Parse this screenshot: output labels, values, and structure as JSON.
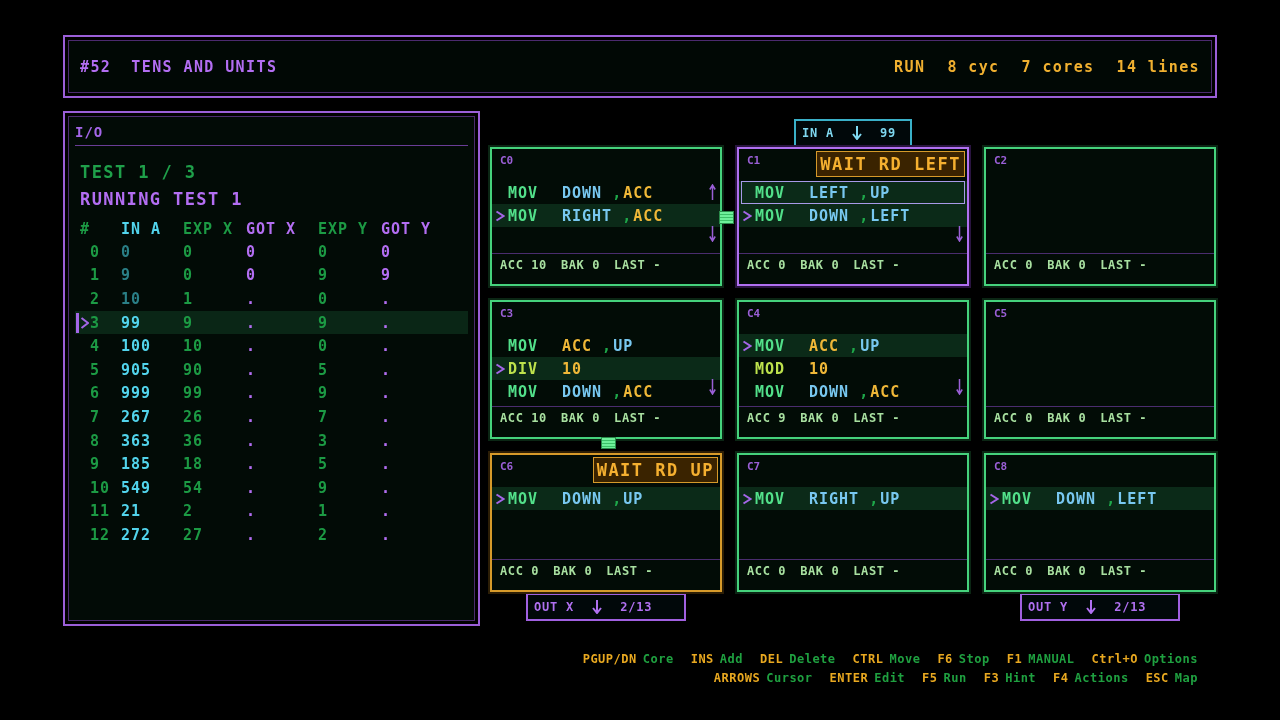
{
  "header": {
    "number": "#52",
    "title": "TENS AND UNITS",
    "stats": [
      "RUN",
      "8 cyc",
      "7 cores",
      "14 lines"
    ]
  },
  "io": {
    "title": "I/O",
    "test": "TEST 1 / 3",
    "status": "RUNNING TEST 1",
    "columns": [
      {
        "label": "#",
        "kind": "index"
      },
      {
        "label": "IN A",
        "kind": "input"
      },
      {
        "label": "EXP X",
        "kind": "expected"
      },
      {
        "label": "GOT X",
        "kind": "got"
      },
      {
        "label": "EXP Y",
        "kind": "expected"
      },
      {
        "label": "GOT Y",
        "kind": "got"
      }
    ],
    "rows": [
      {
        "cells": [
          "0",
          "0",
          "0",
          "0",
          "0",
          "0"
        ],
        "selected": false,
        "consumed": true
      },
      {
        "cells": [
          "1",
          "9",
          "0",
          "0",
          "9",
          "9"
        ],
        "selected": false,
        "consumed": true
      },
      {
        "cells": [
          "2",
          "10",
          "1",
          ".",
          "0",
          "."
        ],
        "selected": false,
        "consumed": true
      },
      {
        "cells": [
          "3",
          "99",
          "9",
          ".",
          "9",
          "."
        ],
        "selected": true,
        "consumed": false
      },
      {
        "cells": [
          "4",
          "100",
          "10",
          ".",
          "0",
          "."
        ],
        "selected": false,
        "consumed": false
      },
      {
        "cells": [
          "5",
          "905",
          "90",
          ".",
          "5",
          "."
        ],
        "selected": false,
        "consumed": false
      },
      {
        "cells": [
          "6",
          "999",
          "99",
          ".",
          "9",
          "."
        ],
        "selected": false,
        "consumed": false
      },
      {
        "cells": [
          "7",
          "267",
          "26",
          ".",
          "7",
          "."
        ],
        "selected": false,
        "consumed": false
      },
      {
        "cells": [
          "8",
          "363",
          "36",
          ".",
          "3",
          "."
        ],
        "selected": false,
        "consumed": false
      },
      {
        "cells": [
          "9",
          "185",
          "18",
          ".",
          "5",
          "."
        ],
        "selected": false,
        "consumed": false
      },
      {
        "cells": [
          "10",
          "549",
          "54",
          ".",
          "9",
          "."
        ],
        "selected": false,
        "consumed": false
      },
      {
        "cells": [
          "11",
          "21",
          "2",
          ".",
          "1",
          "."
        ],
        "selected": false,
        "consumed": false
      },
      {
        "cells": [
          "12",
          "272",
          "27",
          ".",
          "2",
          "."
        ],
        "selected": false,
        "consumed": false
      }
    ]
  },
  "columns": [
    {
      "cores": [
        {
          "label": "C0",
          "selected": false,
          "more_above": true,
          "more_below": true,
          "packet_right": true,
          "lines": [
            {
              "op": "MOV",
              "kind": "move",
              "args": [
                {
                  "text": "DOWN",
                  "kind": "port"
                },
                {
                  "text": "ACC",
                  "kind": "register"
                }
              ],
              "sep": ",",
              "current": false
            },
            {
              "op": "MOV",
              "kind": "move",
              "args": [
                {
                  "text": "RIGHT",
                  "kind": "port"
                },
                {
                  "text": "ACC",
                  "kind": "register"
                }
              ],
              "sep": ",",
              "current": true
            }
          ],
          "registers": [
            "ACC 10",
            "BAK 0",
            "LAST -"
          ]
        },
        {
          "label": "C3",
          "selected": false,
          "more_below": true,
          "packet_down": true,
          "lines": [
            {
              "op": "MOV",
              "kind": "move",
              "args": [
                {
                  "text": "ACC",
                  "kind": "register"
                },
                {
                  "text": "UP",
                  "kind": "port"
                }
              ],
              "sep": ",",
              "current": false
            },
            {
              "op": "DIV",
              "kind": "arith",
              "args": [
                {
                  "text": "10",
                  "kind": "number"
                }
              ],
              "current": true
            },
            {
              "op": "MOV",
              "kind": "move",
              "args": [
                {
                  "text": "DOWN",
                  "kind": "port"
                },
                {
                  "text": "ACC",
                  "kind": "register"
                }
              ],
              "sep": ",",
              "current": false
            }
          ],
          "registers": [
            "ACC 10",
            "BAK 0",
            "LAST -"
          ]
        },
        {
          "label": "C6",
          "selected": false,
          "wait": "WAIT RD UP",
          "lines": [
            {
              "op": "MOV",
              "kind": "move",
              "args": [
                {
                  "text": "DOWN",
                  "kind": "port"
                },
                {
                  "text": "UP",
                  "kind": "port"
                }
              ],
              "sep": ",",
              "current": true
            }
          ],
          "registers": [
            "ACC 0",
            "BAK 0",
            "LAST -"
          ]
        }
      ],
      "output": {
        "label": "OUT X",
        "value": "2/13"
      }
    },
    {
      "input": {
        "label": "IN A",
        "value": "99"
      },
      "cores": [
        {
          "label": "C1",
          "selected": true,
          "wait": "WAIT RD LEFT",
          "more_below": true,
          "lines": [
            {
              "op": "MOV",
              "kind": "move",
              "args": [
                {
                  "text": "LEFT",
                  "kind": "port"
                },
                {
                  "text": "UP",
                  "kind": "port"
                }
              ],
              "sep": ",",
              "current": false,
              "cursor": true
            },
            {
              "op": "MOV",
              "kind": "move",
              "args": [
                {
                  "text": "DOWN",
                  "kind": "port"
                },
                {
                  "text": "LEFT",
                  "kind": "port"
                }
              ],
              "sep": ",",
              "current": true
            }
          ],
          "registers": [
            "ACC 0",
            "BAK 0",
            "LAST -"
          ]
        },
        {
          "label": "C4",
          "selected": false,
          "more_below": true,
          "lines": [
            {
              "op": "MOV",
              "kind": "move",
              "args": [
                {
                  "text": "ACC",
                  "kind": "register"
                },
                {
                  "text": "UP",
                  "kind": "port"
                }
              ],
              "sep": ",",
              "current": true
            },
            {
              "op": "MOD",
              "kind": "arith",
              "args": [
                {
                  "text": "10",
                  "kind": "number"
                }
              ],
              "current": false
            },
            {
              "op": "MOV",
              "kind": "move",
              "args": [
                {
                  "text": "DOWN",
                  "kind": "port"
                },
                {
                  "text": "ACC",
                  "kind": "register"
                }
              ],
              "sep": ",",
              "current": false
            }
          ],
          "registers": [
            "ACC 9",
            "BAK 0",
            "LAST -"
          ]
        },
        {
          "label": "C7",
          "selected": false,
          "lines": [
            {
              "op": "MOV",
              "kind": "move",
              "args": [
                {
                  "text": "RIGHT",
                  "kind": "port"
                },
                {
                  "text": "UP",
                  "kind": "port"
                }
              ],
              "sep": ",",
              "current": true
            }
          ],
          "registers": [
            "ACC 0",
            "BAK 0",
            "LAST -"
          ]
        }
      ]
    },
    {
      "cores": [
        {
          "label": "C2",
          "selected": false,
          "registers": [
            "ACC 0",
            "BAK 0",
            "LAST -"
          ]
        },
        {
          "label": "C5",
          "selected": false,
          "registers": [
            "ACC 0",
            "BAK 0",
            "LAST -"
          ]
        },
        {
          "label": "C8",
          "selected": false,
          "lines": [
            {
              "op": "MOV",
              "kind": "move",
              "args": [
                {
                  "text": "DOWN",
                  "kind": "port"
                },
                {
                  "text": "LEFT",
                  "kind": "port"
                }
              ],
              "sep": ",",
              "current": true
            }
          ],
          "registers": [
            "ACC 0",
            "BAK 0",
            "LAST -"
          ]
        }
      ],
      "output": {
        "label": "OUT Y",
        "value": "2/13"
      }
    }
  ],
  "shortcuts": [
    {
      "items": [
        {
          "key": "PGUP/DN",
          "action": "Core"
        },
        {
          "key": "INS",
          "action": "Add"
        },
        {
          "key": "DEL",
          "action": "Delete"
        },
        {
          "key": "CTRL",
          "action": "Move"
        },
        {
          "key": "F6",
          "action": "Stop"
        },
        {
          "key": "F1",
          "action": "MANUAL"
        },
        {
          "key": "Ctrl+O",
          "action": "Options"
        }
      ]
    },
    {
      "items": [
        {
          "key": "ARROWS",
          "action": "Cursor"
        },
        {
          "key": "ENTER",
          "action": "Edit"
        },
        {
          "key": "F5",
          "action": "Run"
        },
        {
          "key": "F3",
          "action": "Hint"
        },
        {
          "key": "F4",
          "action": "Actions"
        },
        {
          "key": "ESC",
          "action": "Map"
        }
      ]
    }
  ]
}
